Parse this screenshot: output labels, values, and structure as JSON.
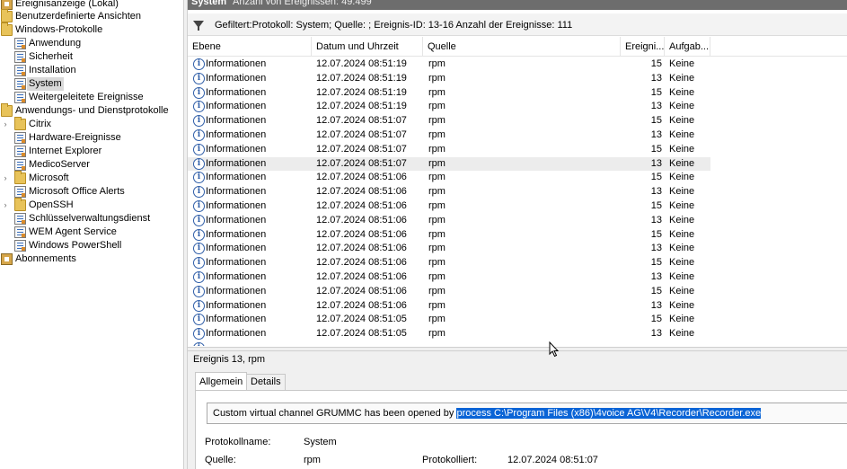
{
  "tree": {
    "nodes": [
      {
        "label": "Ereignisanzeige (Lokal)",
        "icon": "event-viewer-icon",
        "caret": "",
        "selected": false
      },
      {
        "label": "Benutzerdefinierte Ansichten",
        "icon": "folder-icon",
        "caret": "",
        "selected": false
      },
      {
        "label": "Windows-Protokolle",
        "icon": "folder-icon",
        "caret": "",
        "selected": false
      },
      {
        "label": "Anwendung",
        "icon": "log-icon",
        "caret": "",
        "selected": false
      },
      {
        "label": "Sicherheit",
        "icon": "log-icon",
        "caret": "",
        "selected": false
      },
      {
        "label": "Installation",
        "icon": "log-icon",
        "caret": "",
        "selected": false
      },
      {
        "label": "System",
        "icon": "log-icon",
        "caret": "",
        "selected": true
      },
      {
        "label": "Weitergeleitete Ereignisse",
        "icon": "log-icon",
        "caret": "",
        "selected": false
      },
      {
        "label": "Anwendungs- und Dienstprotokolle",
        "icon": "folder-icon",
        "caret": "",
        "selected": false
      },
      {
        "label": "Citrix",
        "icon": "folder-icon",
        "caret": "›",
        "selected": false
      },
      {
        "label": "Hardware-Ereignisse",
        "icon": "log-icon",
        "caret": "",
        "selected": false
      },
      {
        "label": "Internet Explorer",
        "icon": "log-icon",
        "caret": "",
        "selected": false
      },
      {
        "label": "MedicoServer",
        "icon": "log-icon",
        "caret": "",
        "selected": false
      },
      {
        "label": "Microsoft",
        "icon": "folder-icon",
        "caret": "›",
        "selected": false
      },
      {
        "label": "Microsoft Office Alerts",
        "icon": "log-icon",
        "caret": "",
        "selected": false
      },
      {
        "label": "OpenSSH",
        "icon": "folder-icon",
        "caret": "›",
        "selected": false
      },
      {
        "label": "Schlüsselverwaltungsdienst",
        "icon": "log-icon",
        "caret": "",
        "selected": false
      },
      {
        "label": "WEM Agent Service",
        "icon": "log-icon",
        "caret": "",
        "selected": false
      },
      {
        "label": "Windows PowerShell",
        "icon": "log-icon",
        "caret": "",
        "selected": false
      },
      {
        "label": "Abonnements",
        "icon": "event-viewer-icon",
        "caret": "",
        "selected": false
      }
    ]
  },
  "header": {
    "title": "System",
    "count": "Anzahl von Ereignissen: 49.499"
  },
  "filter": {
    "text": "Gefiltert:Protokoll: System; Quelle: ; Ereignis-ID: 13-16 Anzahl der Ereignisse: 111"
  },
  "grid": {
    "columns": [
      "Ebene",
      "Datum und Uhrzeit",
      "Quelle",
      "Ereigni...",
      "Aufgab..."
    ],
    "rows": [
      {
        "level": "Informationen",
        "date": "12.07.2024 08:51:19",
        "source": "rpm",
        "id": "15",
        "task": "Keine"
      },
      {
        "level": "Informationen",
        "date": "12.07.2024 08:51:19",
        "source": "rpm",
        "id": "13",
        "task": "Keine"
      },
      {
        "level": "Informationen",
        "date": "12.07.2024 08:51:19",
        "source": "rpm",
        "id": "15",
        "task": "Keine"
      },
      {
        "level": "Informationen",
        "date": "12.07.2024 08:51:19",
        "source": "rpm",
        "id": "13",
        "task": "Keine"
      },
      {
        "level": "Informationen",
        "date": "12.07.2024 08:51:07",
        "source": "rpm",
        "id": "15",
        "task": "Keine"
      },
      {
        "level": "Informationen",
        "date": "12.07.2024 08:51:07",
        "source": "rpm",
        "id": "13",
        "task": "Keine"
      },
      {
        "level": "Informationen",
        "date": "12.07.2024 08:51:07",
        "source": "rpm",
        "id": "15",
        "task": "Keine"
      },
      {
        "level": "Informationen",
        "date": "12.07.2024 08:51:07",
        "source": "rpm",
        "id": "13",
        "task": "Keine"
      },
      {
        "level": "Informationen",
        "date": "12.07.2024 08:51:06",
        "source": "rpm",
        "id": "15",
        "task": "Keine"
      },
      {
        "level": "Informationen",
        "date": "12.07.2024 08:51:06",
        "source": "rpm",
        "id": "13",
        "task": "Keine"
      },
      {
        "level": "Informationen",
        "date": "12.07.2024 08:51:06",
        "source": "rpm",
        "id": "15",
        "task": "Keine"
      },
      {
        "level": "Informationen",
        "date": "12.07.2024 08:51:06",
        "source": "rpm",
        "id": "13",
        "task": "Keine"
      },
      {
        "level": "Informationen",
        "date": "12.07.2024 08:51:06",
        "source": "rpm",
        "id": "15",
        "task": "Keine"
      },
      {
        "level": "Informationen",
        "date": "12.07.2024 08:51:06",
        "source": "rpm",
        "id": "13",
        "task": "Keine"
      },
      {
        "level": "Informationen",
        "date": "12.07.2024 08:51:06",
        "source": "rpm",
        "id": "15",
        "task": "Keine"
      },
      {
        "level": "Informationen",
        "date": "12.07.2024 08:51:06",
        "source": "rpm",
        "id": "13",
        "task": "Keine"
      },
      {
        "level": "Informationen",
        "date": "12.07.2024 08:51:06",
        "source": "rpm",
        "id": "15",
        "task": "Keine"
      },
      {
        "level": "Informationen",
        "date": "12.07.2024 08:51:06",
        "source": "rpm",
        "id": "13",
        "task": "Keine"
      },
      {
        "level": "Informationen",
        "date": "12.07.2024 08:51:05",
        "source": "rpm",
        "id": "15",
        "task": "Keine"
      },
      {
        "level": "Informationen",
        "date": "12.07.2024 08:51:05",
        "source": "rpm",
        "id": "13",
        "task": "Keine"
      }
    ],
    "highlighted_row": 7
  },
  "detail": {
    "title": "Ereignis 13, rpm",
    "tabs": [
      "Allgemein",
      "Details"
    ],
    "description_plain": "Custom virtual channel GRUMMC has been opened by ",
    "description_selected": "process C:\\Program Files (x86)\\4voice AG\\V4\\Recorder\\Recorder.exe",
    "fields": {
      "protokollname_label": "Protokollname:",
      "protokollname_value": "System",
      "quelle_label": "Quelle:",
      "quelle_value": "rpm",
      "protokolliert_label": "Protokolliert:",
      "protokolliert_value": "12.07.2024 08:51:07"
    }
  },
  "colors": {
    "header_bg": "#6d6d6d",
    "selection_blue": "#0a64d6",
    "info_icon": "#2f5ea8",
    "row_highlight": "#ececec"
  }
}
